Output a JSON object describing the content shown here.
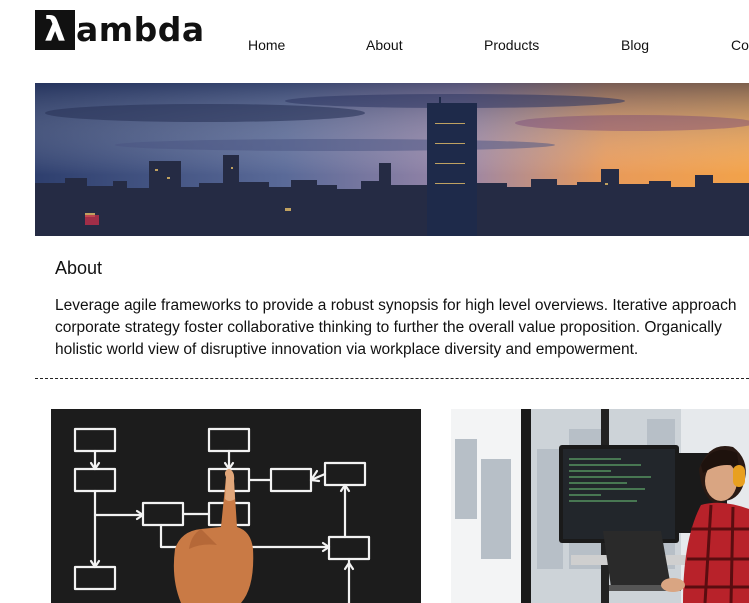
{
  "brand": {
    "logo_glyph": "λ",
    "logo_text": "ambda"
  },
  "nav": {
    "items": [
      "Home",
      "About",
      "Products",
      "Blog",
      "Co"
    ]
  },
  "about": {
    "title": "About",
    "lines": [
      "Leverage agile frameworks to provide a robust synopsis for high level overviews. Iterative approach",
      "corporate strategy foster collaborative thinking to further the overall value proposition. Organically",
      "holistic world view of disruptive innovation via workplace diversity and empowerment."
    ]
  },
  "colors": {
    "text": "#111111",
    "logo_bg": "#111111",
    "sky_top": "#3b4a78",
    "sky_sunset": "#f0a050"
  }
}
